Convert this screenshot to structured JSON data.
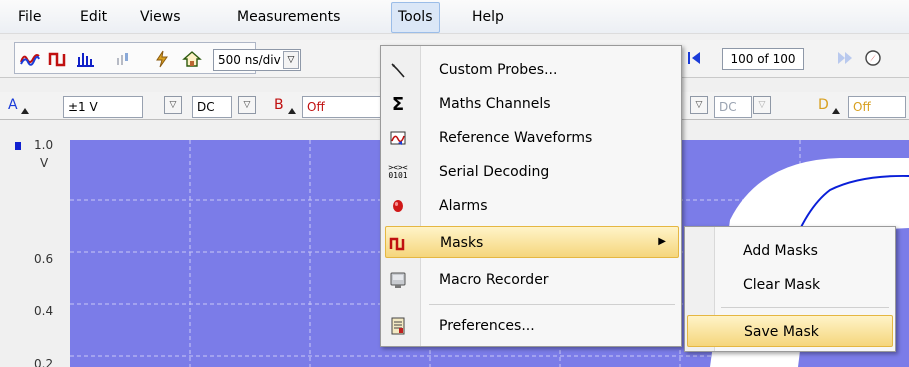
{
  "menubar": {
    "items": [
      {
        "label": "File"
      },
      {
        "label": "Edit"
      },
      {
        "label": "Views"
      },
      {
        "label": "Measurements"
      },
      {
        "label": "Tools"
      },
      {
        "label": "Help"
      }
    ]
  },
  "toolbar": {
    "timebase": "500 ns/div",
    "capture_count": "100 of 100",
    "icons": [
      "scope-mode-icon",
      "persistence-mode-icon",
      "spectrum-mode-icon",
      "disabled-mode-icon",
      "auto-setup-icon",
      "home-icon"
    ]
  },
  "channels": {
    "a": {
      "label": "A",
      "range": "±1 V",
      "coupling": "DC"
    },
    "b": {
      "label": "B",
      "state": "Off"
    },
    "c": {
      "coupling": "DC"
    },
    "d": {
      "label": "D",
      "state": "Off"
    }
  },
  "plot": {
    "y_labels": [
      "1.0",
      "V",
      "0.6",
      "0.4",
      "0.2"
    ],
    "colors": {
      "background": "#7b7ce8",
      "trace": "#0a1fd8"
    }
  },
  "tools_menu": {
    "items": [
      {
        "label": "Custom Probes...",
        "icon": "probe-icon"
      },
      {
        "label": "Maths Channels",
        "icon": "sigma-icon"
      },
      {
        "label": "Reference Waveforms",
        "icon": "reference-waveform-icon"
      },
      {
        "label": "Serial Decoding",
        "icon": "serial-decoding-icon"
      },
      {
        "label": "Alarms",
        "icon": "alarm-icon"
      },
      {
        "label": "Masks",
        "icon": "mask-icon",
        "has_submenu": true
      },
      {
        "label": "Macro Recorder",
        "icon": "macro-recorder-icon"
      },
      {
        "label": "Preferences...",
        "icon": "preferences-icon"
      }
    ],
    "submenu_arrow": "▶"
  },
  "masks_submenu": {
    "items": [
      {
        "label": "Add Masks"
      },
      {
        "label": "Clear Mask"
      },
      {
        "label": "Save Mask"
      }
    ]
  }
}
